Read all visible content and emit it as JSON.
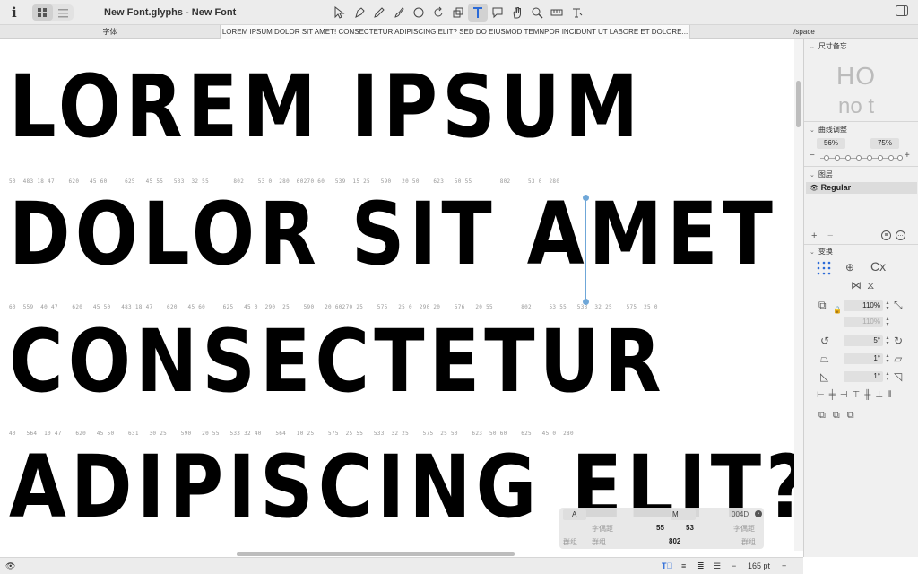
{
  "window": {
    "title": "New Font.glyphs - New Font"
  },
  "toolbar": {
    "info_icon": "info-icon",
    "view_modes": [
      "grid-view-icon",
      "list-view-icon"
    ],
    "tools": [
      "select-tool-icon",
      "draw-tool-icon",
      "pencil-tool-icon",
      "brush-tool-icon",
      "primitives-tool-icon",
      "rotate-tool-icon",
      "scale-tool-icon",
      "text-tool-icon",
      "annotation-tool-icon",
      "hand-tool-icon",
      "zoom-tool-icon",
      "measure-tool-icon",
      "type-tool-icon"
    ],
    "active_tool": "T"
  },
  "tabs": [
    {
      "label": "字体"
    },
    {
      "label": "LOREM IPSUM DOLOR SIT AMET! CONSECTETUR ADIPISCING ELIT? SED DO EIUSMOD TEMNPOR INCIDUNT UT LABORE ET DOLORE..."
    },
    {
      "label": "/space"
    }
  ],
  "canvas": {
    "lines": [
      "LOREM IPSUM",
      "DOLOR SIT AMET",
      "CONSECTETUR",
      "ADIPISCING ELIT?"
    ],
    "metrics": [
      "50  483 18 47    620   45 60     625   45 55   533  32 55       802    53 0  280  60270 60   539  15 25   590   20 50    623   50 55        802     53 0  280",
      "60  559  40 47    620   45 50   483 18 47    620   45 60     625   45 0  290  25    590   20 60270 25    575   25 0  290 20    576   20 55        802     53 55   533  32 25    575  25 0",
      "40   564  10 47    620   45 50    631   30 25    590   20 55   533 32 40    564   10 25    575  25 55   533  32 25    575  25 50    623  50 60    625   45 0  280"
    ]
  },
  "info_box": {
    "glyph_left": "A",
    "glyph_right": "M",
    "unicode": "004D",
    "kern_left_label": "字偶距",
    "kern_right_label": "字偶距",
    "lsb": "55",
    "rsb": "53",
    "width": "802",
    "group_labels": [
      "群组",
      "群组",
      "群组"
    ]
  },
  "panel": {
    "dimensions_header": "尺寸备忘",
    "preview_top": "HO",
    "preview_bottom": "no t",
    "curve_header": "曲线调整",
    "curve_values": [
      "56%",
      "75%"
    ],
    "layers_header": "图层",
    "layer_name": "Regular",
    "transform_header": "变换",
    "transform_origin_label": "Cx",
    "scale_x": "110%",
    "scale_y": "110%",
    "rotate": "5°",
    "slant_a": "1°",
    "slant_b": "1°"
  },
  "statusbar": {
    "zoom_value": "165 pt",
    "minus": "−",
    "plus": "+"
  }
}
